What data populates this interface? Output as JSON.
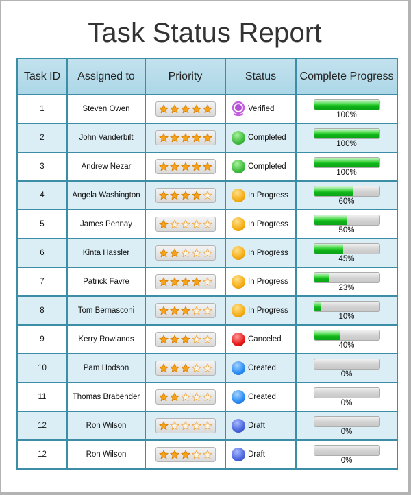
{
  "title": "Task Status Report",
  "colors": {
    "header_bg": "#b9dfec",
    "border": "#3b8ea5",
    "row_alt_bg": "#dbeef5",
    "progress_fill": "#11b41b",
    "status_completed": "#3dbb3d",
    "status_in_progress": "#f5ad16",
    "status_canceled": "#e81b1b",
    "status_created": "#2a8cf3",
    "status_draft": "#4a66dd",
    "status_verified": "#b44fd6",
    "star": "#f7a21b"
  },
  "columns": [
    "Task ID",
    "Assigned to",
    "Priority",
    "Status",
    "Complete Progress"
  ],
  "rows": [
    {
      "id": "1",
      "assigned_to": "Steven Owen",
      "priority_stars": 5,
      "priority_max": 5,
      "status": "Verified",
      "status_icon": "verified",
      "progress": 100,
      "progress_label": "100%"
    },
    {
      "id": "2",
      "assigned_to": "John Vanderbilt",
      "priority_stars": 5,
      "priority_max": 5,
      "status": "Completed",
      "status_icon": "green",
      "progress": 100,
      "progress_label": "100%"
    },
    {
      "id": "3",
      "assigned_to": "Andrew Nezar",
      "priority_stars": 5,
      "priority_max": 5,
      "status": "Completed",
      "status_icon": "green",
      "progress": 100,
      "progress_label": "100%"
    },
    {
      "id": "4",
      "assigned_to": "Angela Washington",
      "priority_stars": 4,
      "priority_max": 5,
      "status": "In Progress",
      "status_icon": "orange",
      "progress": 60,
      "progress_label": "60%"
    },
    {
      "id": "5",
      "assigned_to": "James Pennay",
      "priority_stars": 1,
      "priority_max": 5,
      "status": "In Progress",
      "status_icon": "orange",
      "progress": 50,
      "progress_label": "50%"
    },
    {
      "id": "6",
      "assigned_to": "Kinta Hassler",
      "priority_stars": 2,
      "priority_max": 5,
      "status": "In Progress",
      "status_icon": "orange",
      "progress": 45,
      "progress_label": "45%"
    },
    {
      "id": "7",
      "assigned_to": "Patrick Favre",
      "priority_stars": 4,
      "priority_max": 5,
      "status": "In Progress",
      "status_icon": "orange",
      "progress": 23,
      "progress_label": "23%"
    },
    {
      "id": "8",
      "assigned_to": "Tom Bernasconi",
      "priority_stars": 3,
      "priority_max": 5,
      "status": "In Progress",
      "status_icon": "orange",
      "progress": 10,
      "progress_label": "10%"
    },
    {
      "id": "9",
      "assigned_to": "Kerry Rowlands",
      "priority_stars": 3,
      "priority_max": 5,
      "status": "Canceled",
      "status_icon": "red",
      "progress": 40,
      "progress_label": "40%"
    },
    {
      "id": "10",
      "assigned_to": "Pam Hodson",
      "priority_stars": 3,
      "priority_max": 5,
      "status": "Created",
      "status_icon": "blue",
      "progress": 0,
      "progress_label": "0%"
    },
    {
      "id": "11",
      "assigned_to": "Thomas Brabender",
      "priority_stars": 2,
      "priority_max": 5,
      "status": "Created",
      "status_icon": "blue",
      "progress": 0,
      "progress_label": "0%"
    },
    {
      "id": "12",
      "assigned_to": "Ron Wilson",
      "priority_stars": 1,
      "priority_max": 5,
      "status": "Draft",
      "status_icon": "indigo",
      "progress": 0,
      "progress_label": "0%"
    },
    {
      "id": "12",
      "assigned_to": "Ron Wilson",
      "priority_stars": 3,
      "priority_max": 5,
      "status": "Draft",
      "status_icon": "indigo",
      "progress": 0,
      "progress_label": "0%"
    }
  ]
}
